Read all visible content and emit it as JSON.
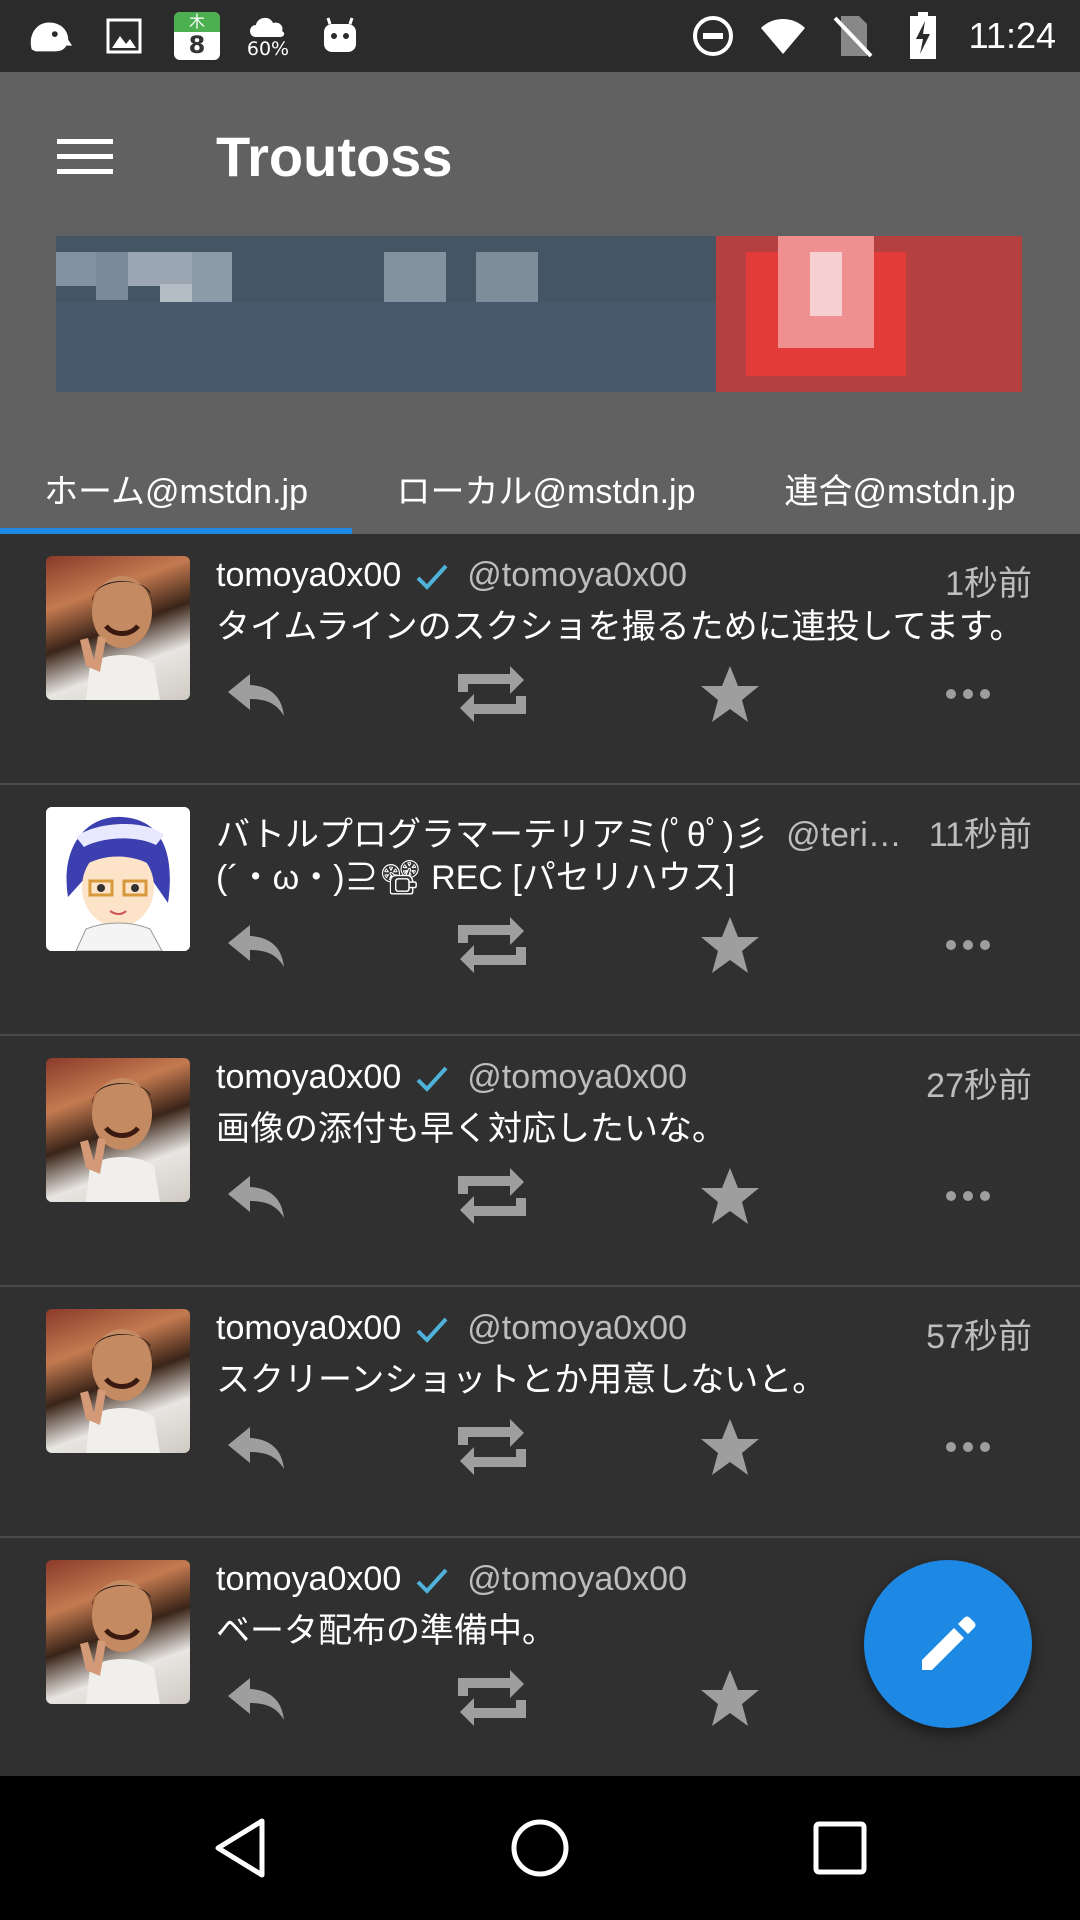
{
  "status_bar": {
    "time": "11:24",
    "calendar_day": "木",
    "calendar_date": "8",
    "weather_percent": "60%",
    "icons": [
      "app-icon",
      "image-icon",
      "calendar-icon",
      "weather-icon",
      "android-icon",
      "dnd-icon",
      "wifi-icon",
      "no-sim-icon",
      "battery-charging-icon"
    ]
  },
  "app_bar": {
    "title": "Troutoss",
    "accent_color": "#1e88e5",
    "background_color": "#616161"
  },
  "tabs": [
    {
      "label": "ホーム@mstdn.jp",
      "selected": true
    },
    {
      "label": "ローカル@mstdn.jp",
      "selected": false
    },
    {
      "label": "連合@mstdn.jp",
      "selected": false
    }
  ],
  "posts": [
    {
      "display_name": "tomoya0x00",
      "verified": true,
      "handle": "@tomoya0x00",
      "time": "1秒前",
      "content": "タイムラインのスクショを撮るために連投してます。"
    },
    {
      "display_name": "バトルプログラマーテリアミ(ﾟθﾟ)彡",
      "verified": false,
      "handle": "@teri…",
      "time": "11秒前",
      "content": "(´・ω・)⊇📽 REC [パセリハウス]"
    },
    {
      "display_name": "tomoya0x00",
      "verified": true,
      "handle": "@tomoya0x00",
      "time": "27秒前",
      "content": "画像の添付も早く対応したいな。"
    },
    {
      "display_name": "tomoya0x00",
      "verified": true,
      "handle": "@tomoya0x00",
      "time": "57秒前",
      "content": "スクリーンショットとか用意しないと。"
    },
    {
      "display_name": "tomoya0x00",
      "verified": true,
      "handle": "@tomoya0x00",
      "time": "",
      "content": "ベータ配布の準備中。"
    }
  ],
  "post_actions": [
    "reply-icon",
    "boost-icon",
    "favourite-icon",
    "more-icon"
  ],
  "fab": {
    "icon": "compose-icon"
  },
  "nav_bar": {
    "buttons": [
      "back-icon",
      "home-icon",
      "recents-icon"
    ]
  }
}
